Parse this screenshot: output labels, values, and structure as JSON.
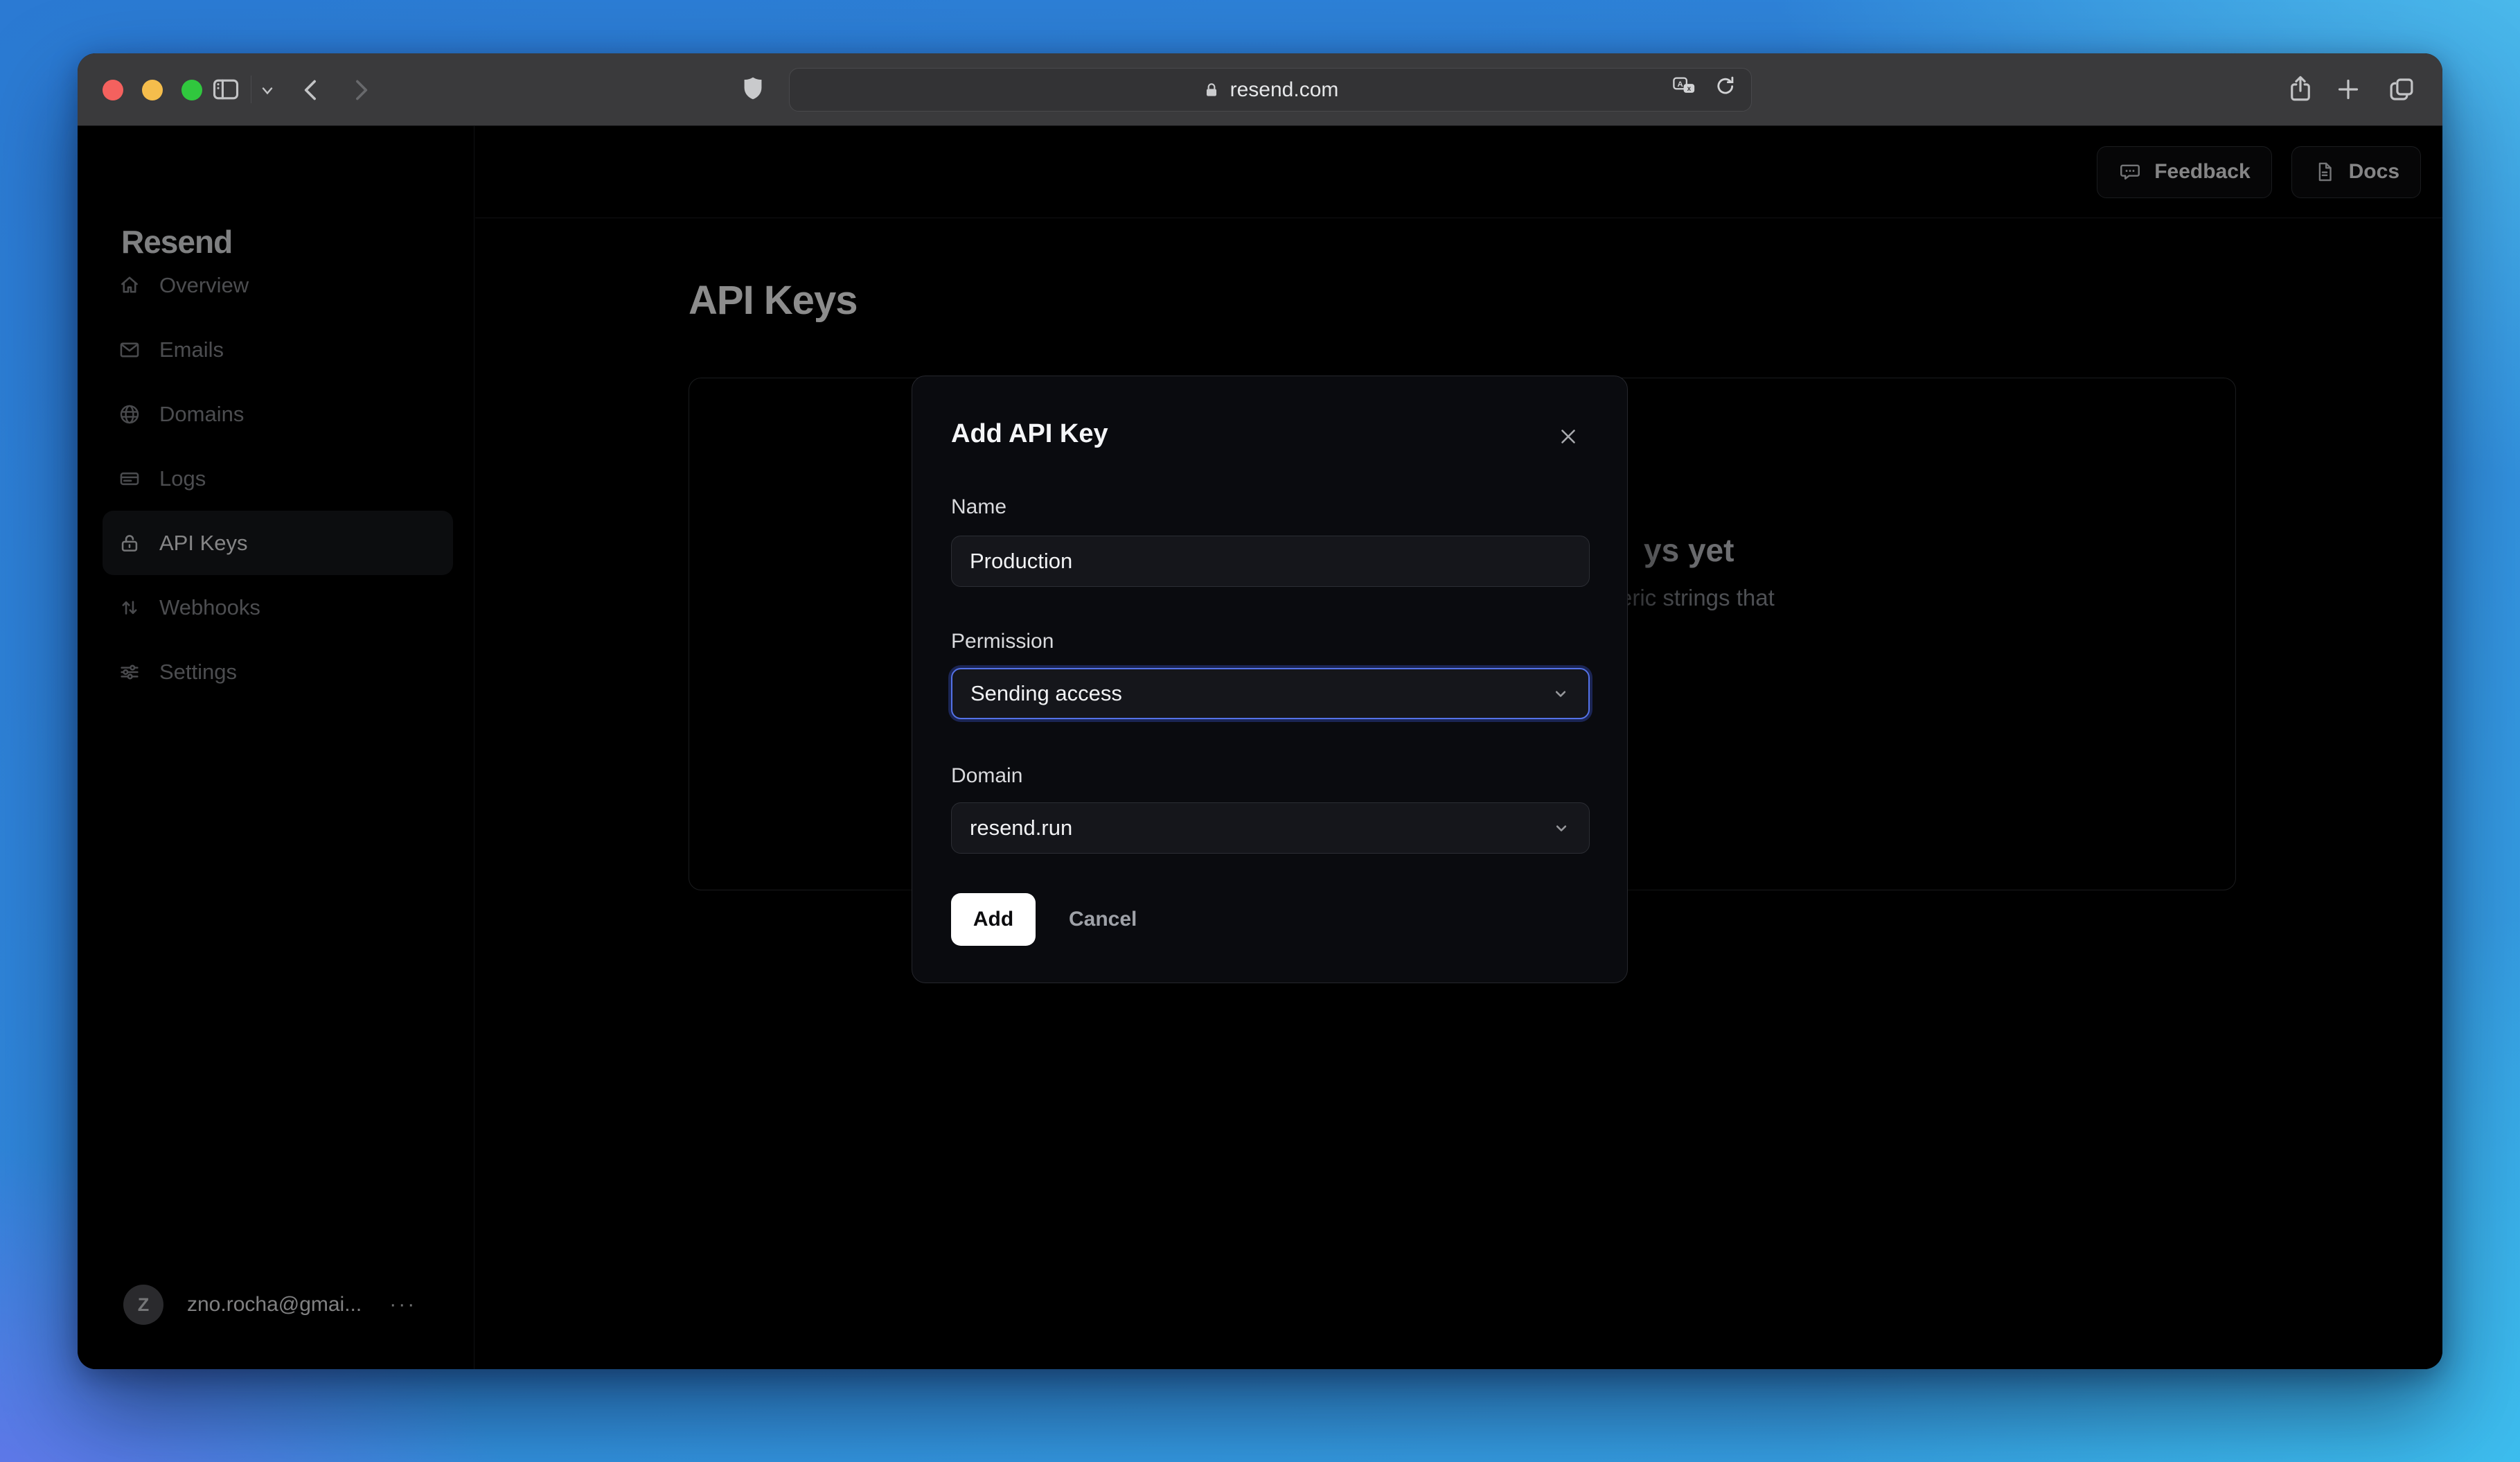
{
  "browser": {
    "url": "resend.com",
    "icons": [
      "sidebar-toggle",
      "chevron-down",
      "back",
      "forward",
      "shield",
      "lock",
      "translate",
      "reload",
      "share",
      "new-tab",
      "tabs-overview"
    ]
  },
  "sidebar": {
    "logo": "Resend",
    "items": [
      {
        "label": "Overview",
        "icon": "home",
        "active": false
      },
      {
        "label": "Emails",
        "icon": "envelope",
        "active": false
      },
      {
        "label": "Domains",
        "icon": "globe",
        "active": false
      },
      {
        "label": "Logs",
        "icon": "logs",
        "active": false
      },
      {
        "label": "API Keys",
        "icon": "lock",
        "active": true
      },
      {
        "label": "Webhooks",
        "icon": "arrows-up-down",
        "active": false
      },
      {
        "label": "Settings",
        "icon": "sliders",
        "active": false
      }
    ],
    "user": {
      "initial": "Z",
      "email": "zno.rocha@gmai...",
      "menu": "···"
    }
  },
  "header": {
    "feedback_label": "Feedback",
    "docs_label": "Docs"
  },
  "main": {
    "title": "API Keys",
    "background_fragments": {
      "heading": "ys yet",
      "body": "eric strings that"
    }
  },
  "modal": {
    "title": "Add API Key",
    "name_label": "Name",
    "name_value": "Production",
    "permission_label": "Permission",
    "permission_value": "Sending access",
    "domain_label": "Domain",
    "domain_value": "resend.run",
    "add_label": "Add",
    "cancel_label": "Cancel"
  },
  "colors": {
    "accent_focus": "#5472e8",
    "gradient_blue": "#2b7ad3",
    "gradient_cyan": "#3fc6f2",
    "gradient_purple": "#7b6cf0",
    "traffic_red": "#f4615e",
    "traffic_yellow": "#f5bd4c",
    "traffic_green": "#30c73e",
    "add_button_bg": "#ffffff"
  }
}
